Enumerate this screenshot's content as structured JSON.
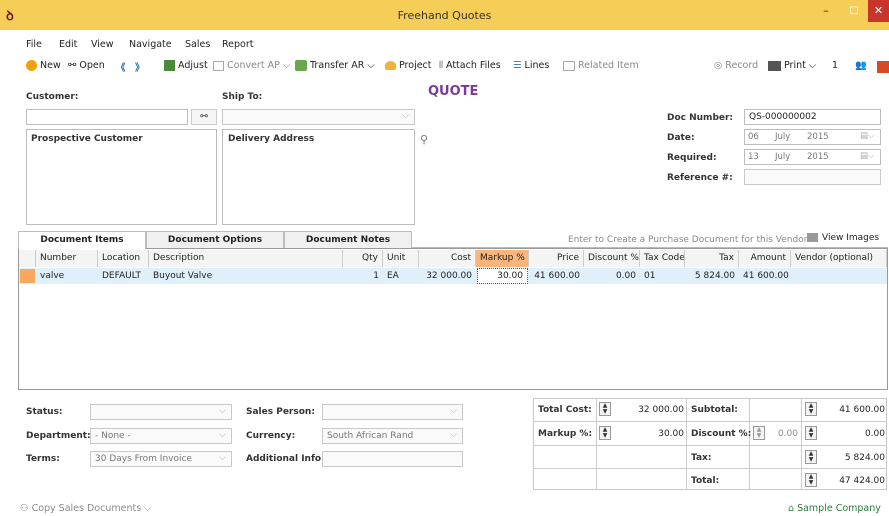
{
  "window": {
    "title": "Freehand Quotes",
    "minimize": "–",
    "maximize": "□",
    "close": "✕"
  },
  "menu": [
    "File",
    "Edit",
    "View",
    "Navigate",
    "Sales",
    "Report"
  ],
  "toolbar": {
    "new": "New",
    "open": "Open",
    "adjust": "Adjust",
    "convert_ap": "Convert AP",
    "transfer_ar": "Transfer AR",
    "project": "Project",
    "attach": "Attach Files",
    "lines": "Lines",
    "related": "Related Item",
    "record": "Record",
    "print": "Print",
    "print_count": "1"
  },
  "form": {
    "heading": "QUOTE",
    "customer_label": "Customer:",
    "ship_to_label": "Ship To:",
    "customer_address": "Prospective Customer",
    "delivery_address": "Delivery Address",
    "doc_number_label": "Doc Number:",
    "doc_number": "QS-000000002",
    "date_label": "Date:",
    "date": {
      "day": "06",
      "month": "July",
      "year": "2015"
    },
    "required_label": "Required:",
    "required": {
      "day": "13",
      "month": "July",
      "year": "2015"
    },
    "reference_label": "Reference #:"
  },
  "tabs": [
    "Document Items",
    "Document Options",
    "Document Notes"
  ],
  "vendor_hint": "Enter to Create a Purchase Document for this Vendor",
  "view_images": "View Images",
  "grid": {
    "headers": [
      "Number",
      "Location",
      "Description",
      "Qty",
      "Unit",
      "Cost",
      "Markup %",
      "Price",
      "Discount %",
      "Tax Code",
      "Tax",
      "Amount",
      "Vendor (optional)"
    ],
    "rows": [
      [
        "valve",
        "DEFAULT",
        "Buyout Valve",
        "1",
        "EA",
        "32 000.00",
        "30.00",
        "41 600.00",
        "0.00",
        "01",
        "5 824.00",
        "41 600.00",
        ""
      ]
    ]
  },
  "bottom": {
    "status_label": "Status:",
    "department_label": "Department:",
    "department": "- None -",
    "terms_label": "Terms:",
    "terms": "30 Days From Invoice",
    "sales_person_label": "Sales Person:",
    "currency_label": "Currency:",
    "currency": "South African Rand",
    "additional_label": "Additional Info:"
  },
  "totals": {
    "total_cost_label": "Total Cost:",
    "total_cost": "32 000.00",
    "markup_label": "Markup %:",
    "markup": "30.00",
    "subtotal_label": "Subtotal:",
    "subtotal": "41 600.00",
    "discount_label": "Discount %:",
    "discount_pct": "0.00",
    "discount": "0.00",
    "tax_label": "Tax:",
    "tax": "5 824.00",
    "total_label": "Total:",
    "total": "47 424.00"
  },
  "status_bar": {
    "copy": "Copy Sales Documents",
    "company": "Sample Company"
  }
}
